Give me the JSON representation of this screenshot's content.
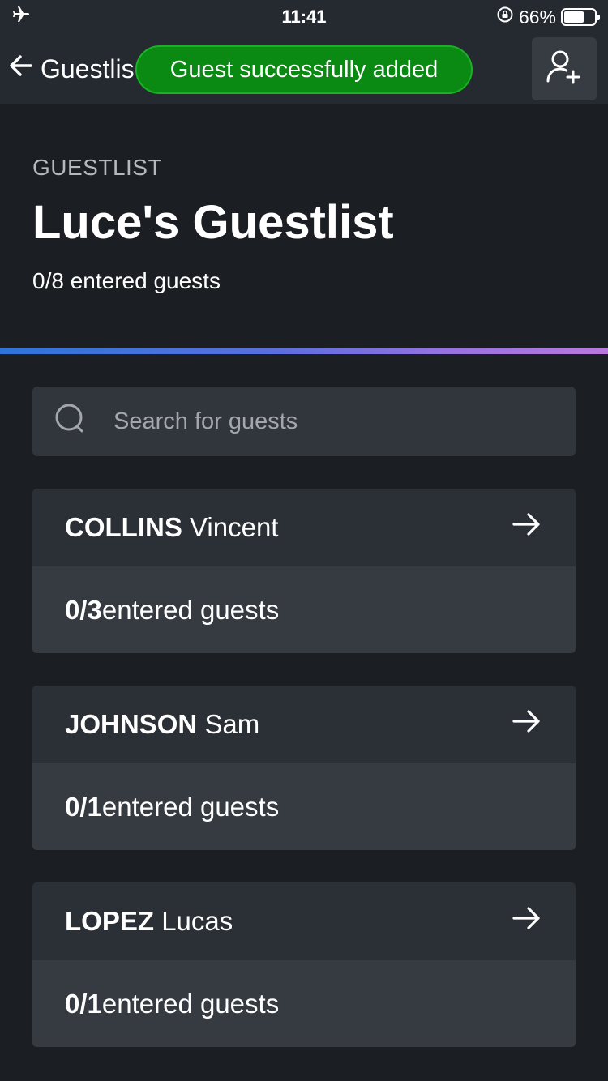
{
  "status_bar": {
    "time": "11:41",
    "battery_percent": "66%",
    "battery_level": 0.66
  },
  "nav": {
    "back_label": "Guestlis",
    "toast": "Guest successfully added"
  },
  "header": {
    "eyebrow": "GUESTLIST",
    "title": "Luce's Guestlist",
    "subtitle": "0/8 entered guests"
  },
  "search": {
    "placeholder": "Search for guests"
  },
  "guests": [
    {
      "surname": "COLLINS",
      "first_name": "Vincent",
      "count": "0/3",
      "label": "entered guests"
    },
    {
      "surname": "JOHNSON",
      "first_name": "Sam",
      "count": "0/1",
      "label": "entered guests"
    },
    {
      "surname": "LOPEZ",
      "first_name": "Lucas",
      "count": "0/1",
      "label": "entered guests"
    }
  ],
  "colors": {
    "background": "#1b1e23",
    "toast": "#0a8a12",
    "gradient_start": "#2e74d8",
    "gradient_end": "#b879dc"
  },
  "icons": [
    "airplane-icon",
    "orientation-lock-icon",
    "battery-icon",
    "back-arrow-icon",
    "add-user-icon",
    "search-icon",
    "arrow-right-icon"
  ]
}
